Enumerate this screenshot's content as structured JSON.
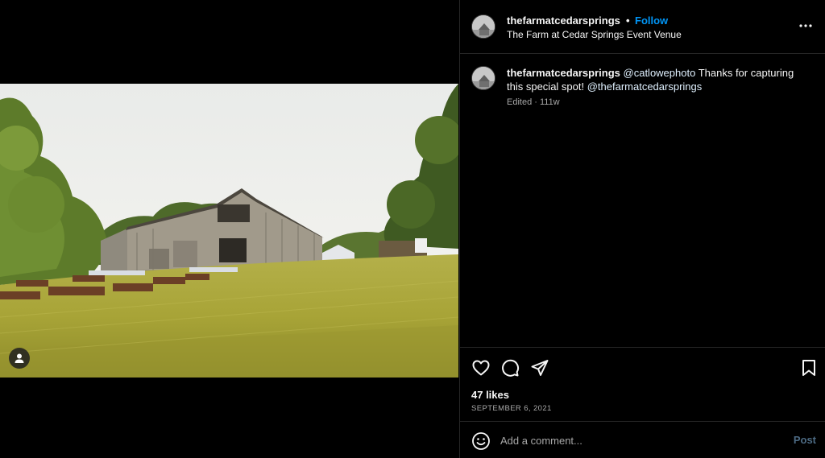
{
  "post": {
    "username": "thefarmatcedarsprings",
    "separator": "•",
    "follow_label": "Follow",
    "location": "The Farm at Cedar Springs Event Venue"
  },
  "caption": {
    "username": "thefarmatcedarsprings",
    "mention_1": "@catlowephoto",
    "text_1": " Thanks for capturing this special spot! ",
    "mention_2": "@thefarmatcedarsprings",
    "meta": "Edited · 111w"
  },
  "engagement": {
    "likes": "47 likes",
    "date": "SEPTEMBER 6, 2021"
  },
  "comment": {
    "placeholder": "Add a comment...",
    "post_label": "Post"
  },
  "icons": {
    "more": "more-options-icon",
    "like": "heart-icon",
    "comment": "comment-icon",
    "share": "send-icon",
    "save": "bookmark-icon",
    "emoji": "emoji-icon",
    "tag": "user-tag-icon"
  },
  "colors": {
    "accent": "#0095f6",
    "mention": "#e0f1ff",
    "muted": "#a8a8a8",
    "divider": "#262626"
  }
}
